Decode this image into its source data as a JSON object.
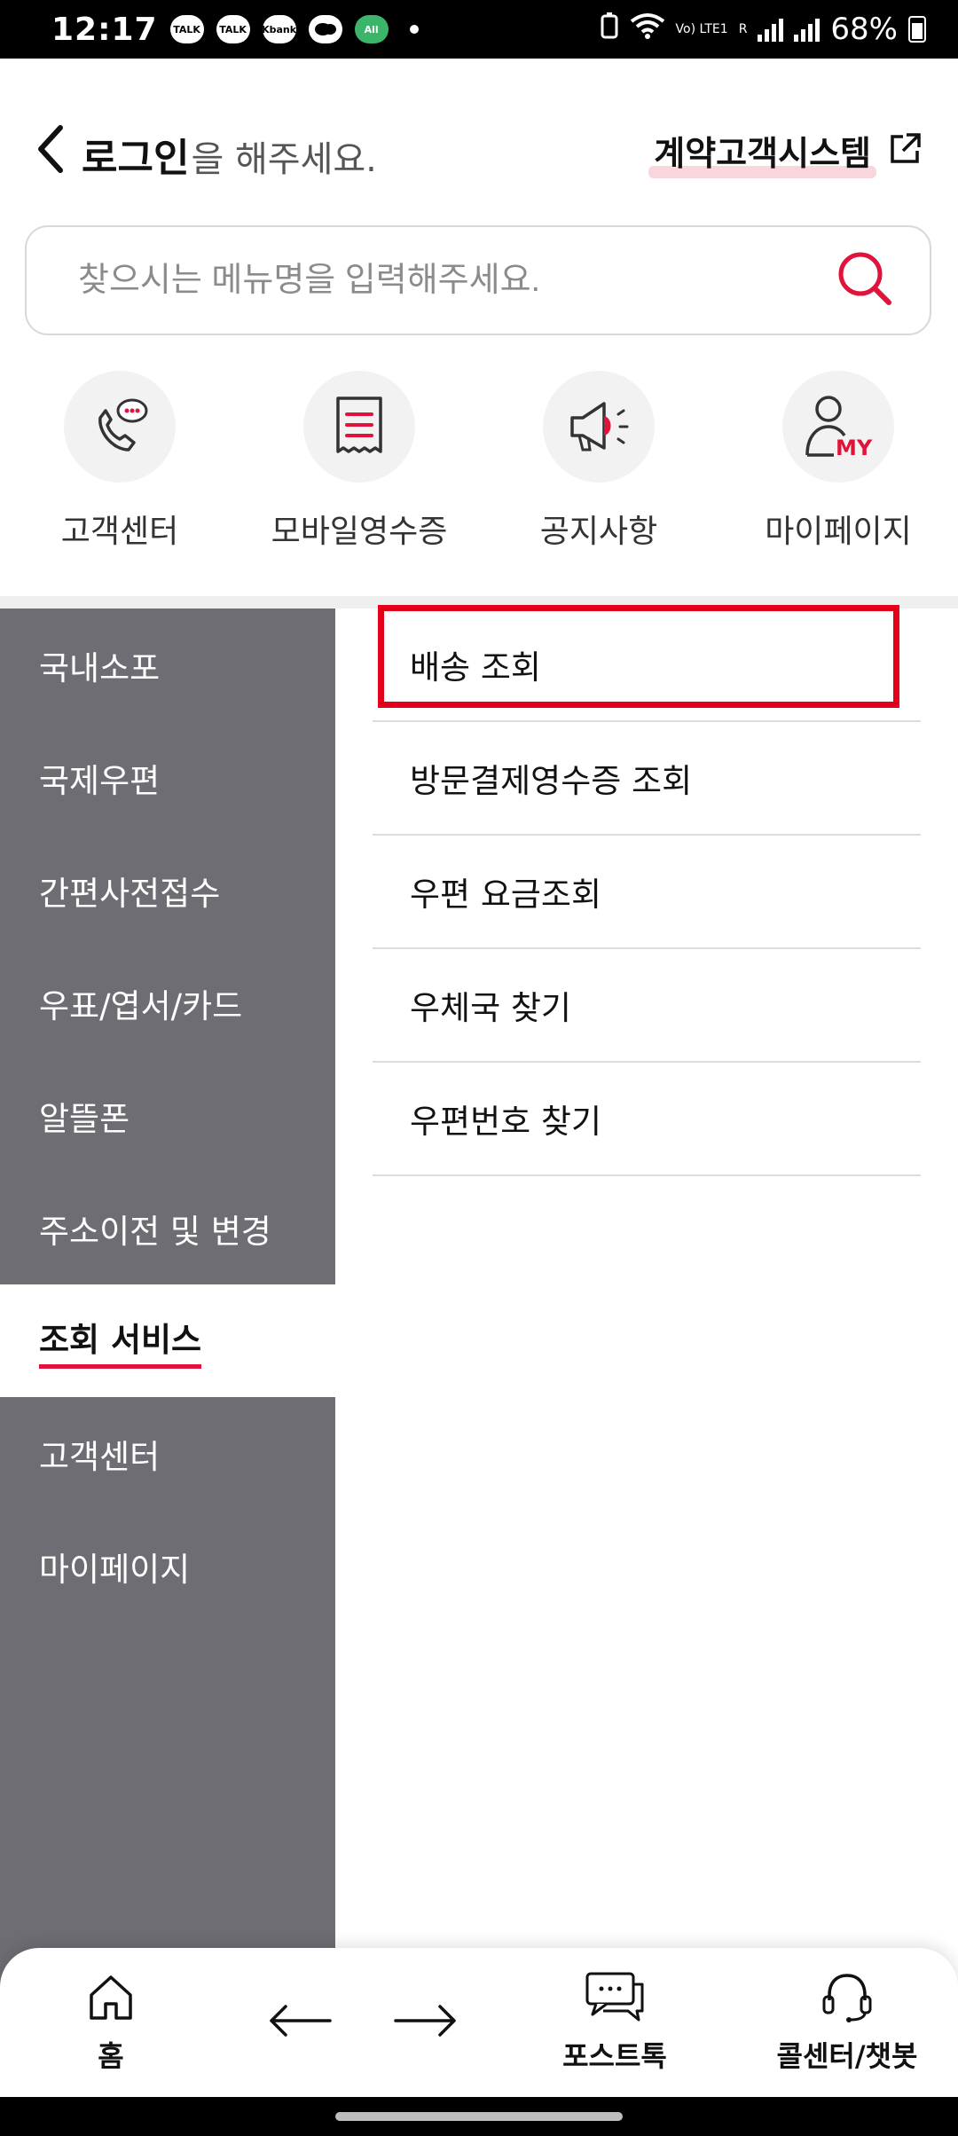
{
  "status_bar": {
    "time": "12:17",
    "notification_icons": [
      "TALK",
      "TALK",
      "Kbank",
      "",
      "All"
    ],
    "network_label": "Vo) LTE1",
    "signal_label": "R",
    "battery_percent": "68%"
  },
  "header": {
    "login_strong": "로그인",
    "login_rest": "을 해주세요.",
    "contract_link": "계약고객시스템"
  },
  "search": {
    "placeholder": "찾으시는 메뉴명을 입력해주세요."
  },
  "quick_menu": [
    {
      "label": "고객센터",
      "icon": "phone-chat-icon"
    },
    {
      "label": "모바일영수증",
      "icon": "receipt-icon"
    },
    {
      "label": "공지사항",
      "icon": "megaphone-icon"
    },
    {
      "label": "마이페이지",
      "icon": "my-page-icon",
      "icon_text": "MY"
    }
  ],
  "left_nav": [
    {
      "label": "국내소포",
      "active": false
    },
    {
      "label": "국제우편",
      "active": false
    },
    {
      "label": "간편사전접수",
      "active": false
    },
    {
      "label": "우표/엽서/카드",
      "active": false
    },
    {
      "label": "알뜰폰",
      "active": false
    },
    {
      "label": "주소이전 및 변경",
      "active": false
    },
    {
      "label": "조회 서비스",
      "active": true
    },
    {
      "label": "고객센터",
      "active": false
    },
    {
      "label": "마이페이지",
      "active": false
    }
  ],
  "right_menu": [
    {
      "label": "배송 조회",
      "highlighted": true
    },
    {
      "label": "방문결제영수증 조회",
      "highlighted": false
    },
    {
      "label": "우편 요금조회",
      "highlighted": false
    },
    {
      "label": "우체국 찾기",
      "highlighted": false
    },
    {
      "label": "우편번호 찾기",
      "highlighted": false
    }
  ],
  "tab_bar": {
    "home": "홈",
    "posttalk": "포스트톡",
    "callcenter": "콜센터/챗봇"
  },
  "colors": {
    "accent_red": "#e0133a",
    "nav_gray": "#6e6d74",
    "highlight_box": "#e3001b"
  }
}
